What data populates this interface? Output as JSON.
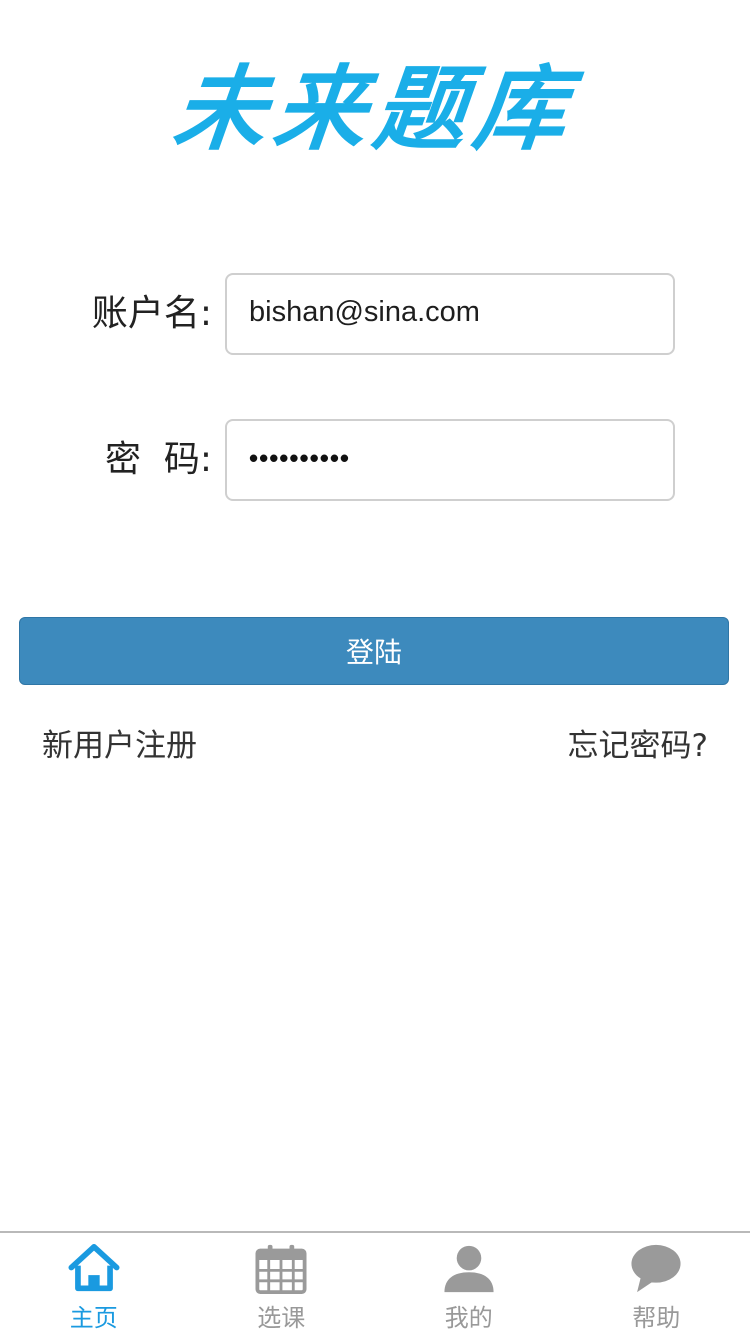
{
  "app": {
    "logo_text": "未来题库"
  },
  "form": {
    "username_label": "账户名:",
    "username_value": "bishan@sina.com",
    "password_label": "密  码:",
    "password_masked": "••••••••••"
  },
  "actions": {
    "login_label": "登陆",
    "register_link": "新用户注册",
    "forgot_link": "忘记密码?"
  },
  "tabbar": {
    "tabs": [
      {
        "label": "主页",
        "icon": "home-icon",
        "active": true
      },
      {
        "label": "选课",
        "icon": "calendar-icon",
        "active": false
      },
      {
        "label": "我的",
        "icon": "user-icon",
        "active": false
      },
      {
        "label": "帮助",
        "icon": "chat-bubble-icon",
        "active": false
      }
    ]
  },
  "colors": {
    "accent": "#1a9ae0",
    "logo": "#1aaee8",
    "button": "#3d8abd",
    "inactive": "#999999"
  }
}
